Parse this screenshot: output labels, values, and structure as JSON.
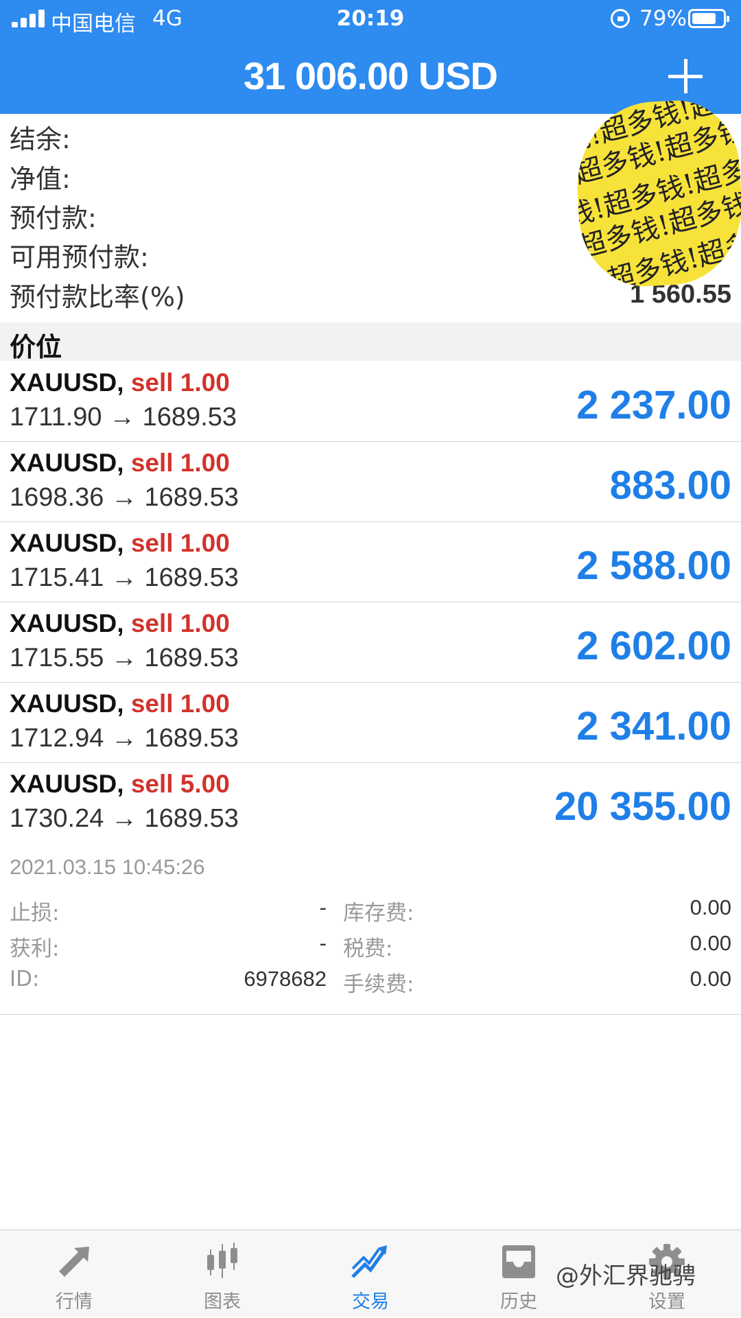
{
  "status_bar": {
    "carrier": "中国电信",
    "network": "4G",
    "time": "20:19",
    "battery_percent": "79%",
    "battery_level": 0.79
  },
  "header": {
    "title": "31 006.00 USD",
    "add_icon": "plus-icon"
  },
  "summary": {
    "balance_label": "结余:",
    "equity_label": "净值:",
    "margin_label": "预付款:",
    "free_margin_label": "可用预付款:",
    "margin_level_label": "预付款比率(%)",
    "margin_level_value": "1 560.55",
    "sticker_text": "钱!超多钱!超多钱!超多钱!"
  },
  "section": {
    "title": "价位"
  },
  "positions": [
    {
      "symbol": "XAUUSD,",
      "side": "sell 1.00",
      "prices": "1711.90 → 1689.53",
      "profit": "2 237.00"
    },
    {
      "symbol": "XAUUSD,",
      "side": "sell 1.00",
      "prices": "1698.36 → 1689.53",
      "profit": "883.00"
    },
    {
      "symbol": "XAUUSD,",
      "side": "sell 1.00",
      "prices": "1715.41 → 1689.53",
      "profit": "2 588.00"
    },
    {
      "symbol": "XAUUSD,",
      "side": "sell 1.00",
      "prices": "1715.55 → 1689.53",
      "profit": "2 602.00"
    },
    {
      "symbol": "XAUUSD,",
      "side": "sell 1.00",
      "prices": "1712.94 → 1689.53",
      "profit": "2 341.00"
    },
    {
      "symbol": "XAUUSD,",
      "side": "sell 5.00",
      "prices": "1730.24 → 1689.53",
      "profit": "20 355.00"
    }
  ],
  "details": {
    "open_time": "2021.03.15 10:45:26",
    "stop_loss_label": "止损:",
    "stop_loss_value": "-",
    "swap_label": "库存费:",
    "swap_value": "0.00",
    "take_profit_label": "获利:",
    "take_profit_value": "-",
    "taxes_label": "税费:",
    "taxes_value": "0.00",
    "id_label": "ID:",
    "id_value": "6978682",
    "commission_label": "手续费:",
    "commission_value": "0.00"
  },
  "tabs": [
    {
      "label": "行情",
      "icon": "quotes-arrows-icon",
      "active": false
    },
    {
      "label": "图表",
      "icon": "candlestick-icon",
      "active": false
    },
    {
      "label": "交易",
      "icon": "trade-trend-icon",
      "active": true
    },
    {
      "label": "历史",
      "icon": "history-inbox-icon",
      "active": false
    },
    {
      "label": "设置",
      "icon": "gear-icon",
      "active": false
    }
  ],
  "watermark": "@外汇界驰骋",
  "colors": {
    "header_blue": "#2e8bf0",
    "profit_blue": "#1f7fe8",
    "sell_red": "#d1332c",
    "sticker_yellow": "#f7e23a"
  }
}
